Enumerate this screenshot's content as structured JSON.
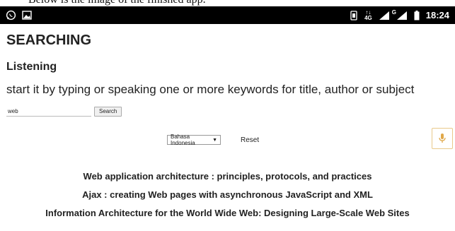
{
  "caption": "Below is the image of the finished app.",
  "statusbar": {
    "network": "4G",
    "network_arrows": "↑↓",
    "carrier_label": "G",
    "time": "18:24"
  },
  "page": {
    "title": "SEARCHING",
    "subtitle": "Listening",
    "description": "start it by typing or speaking one or more keywords for title, author or subject"
  },
  "search": {
    "value": "web",
    "button_label": "Search"
  },
  "language": {
    "selected": "Bahasa Indonesia",
    "reset_label": "Reset"
  },
  "results": [
    "Web application architecture : principles, protocols, and practices",
    "Ajax : creating Web pages with asynchronous JavaScript and XML",
    "Information Architecture for the World Wide Web: Designing Large-Scale Web Sites"
  ],
  "colors": {
    "mic_border": "#e9c98a",
    "mic_icon": "#e0a84a"
  },
  "icons": [
    "whatsapp-icon",
    "image-icon",
    "vibrate-icon",
    "signal-icon",
    "battery-icon",
    "microphone-icon",
    "dropdown-arrow-icon"
  ]
}
